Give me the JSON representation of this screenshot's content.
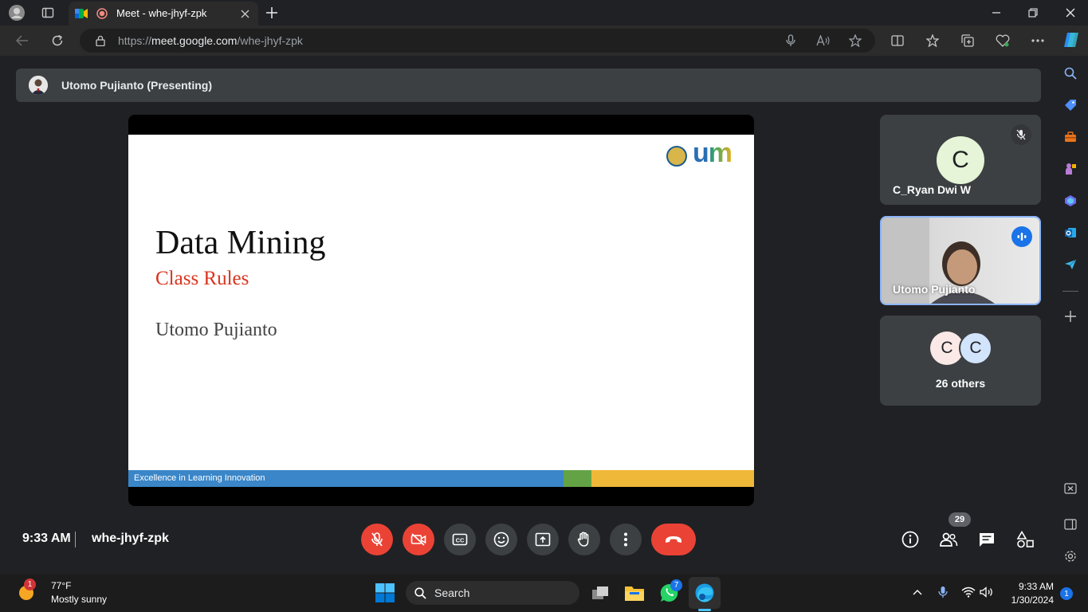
{
  "browser": {
    "tab_title": "Meet - whe-jhyf-zpk",
    "url_prefix": "https://",
    "url_host": "meet.google.com",
    "url_path": "/whe-jhyf-zpk"
  },
  "meet": {
    "presenting_label": "Utomo Pujianto (Presenting)",
    "slide": {
      "title": "Data Mining",
      "subtitle": "Class Rules",
      "author": "Utomo Pujianto",
      "logo_text": "um",
      "footer": "Excellence in Learning Innovation"
    },
    "tiles": [
      {
        "initial": "C",
        "name": "C_Ryan Dwi W",
        "muted": true
      },
      {
        "name": "Utomo Pujianto",
        "speaking": true
      },
      {
        "initials": [
          "C",
          "C"
        ],
        "label": "26 others"
      }
    ],
    "time": "9:33 AM",
    "meeting_code": "whe-jhyf-zpk",
    "participant_count": "29"
  },
  "taskbar": {
    "weather_temp": "77°F",
    "weather_desc": "Mostly sunny",
    "weather_badge": "1",
    "search_label": "Search",
    "whatsapp_badge": "7",
    "clock_time": "9:33 AM",
    "clock_date": "1/30/2024",
    "notification_count": "1"
  },
  "colors": {
    "meet_bg": "#202124",
    "tile_bg": "#3c4043",
    "danger": "#ea4335",
    "accent": "#8ab4f8"
  }
}
